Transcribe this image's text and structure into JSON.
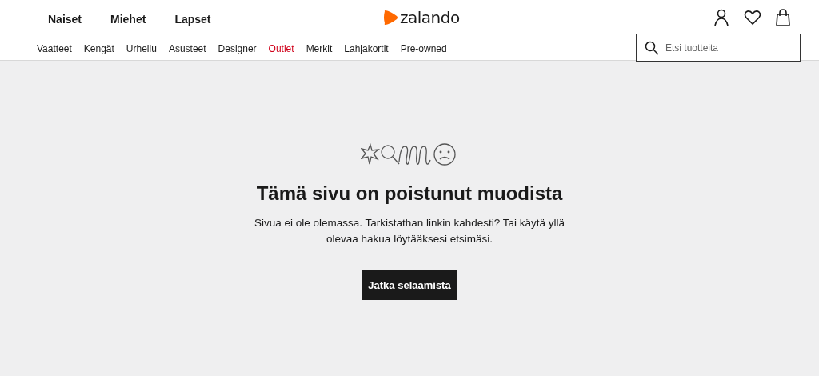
{
  "header": {
    "genders": [
      {
        "label": "Naiset"
      },
      {
        "label": "Miehet"
      },
      {
        "label": "Lapset"
      }
    ],
    "logo": "zalando",
    "categories": [
      {
        "label": "Vaatteet",
        "highlighted": false
      },
      {
        "label": "Kengät",
        "highlighted": false
      },
      {
        "label": "Urheilu",
        "highlighted": false
      },
      {
        "label": "Asusteet",
        "highlighted": false
      },
      {
        "label": "Designer",
        "highlighted": false
      },
      {
        "label": "Outlet",
        "highlighted": true
      },
      {
        "label": "Merkit",
        "highlighted": false
      },
      {
        "label": "Lahjakortit",
        "highlighted": false
      },
      {
        "label": "Pre-owned",
        "highlighted": false
      }
    ],
    "search": {
      "placeholder": "Etsi tuotteita"
    }
  },
  "error": {
    "title": "Tämä sivu on poistunut muodista",
    "message": "Sivua ei ole olemassa. Tarkistathan linkin kahdesti? Tai käytä yllä olevaa hakua löytääksesi etsimäsi.",
    "button": "Jatka selaamista"
  }
}
